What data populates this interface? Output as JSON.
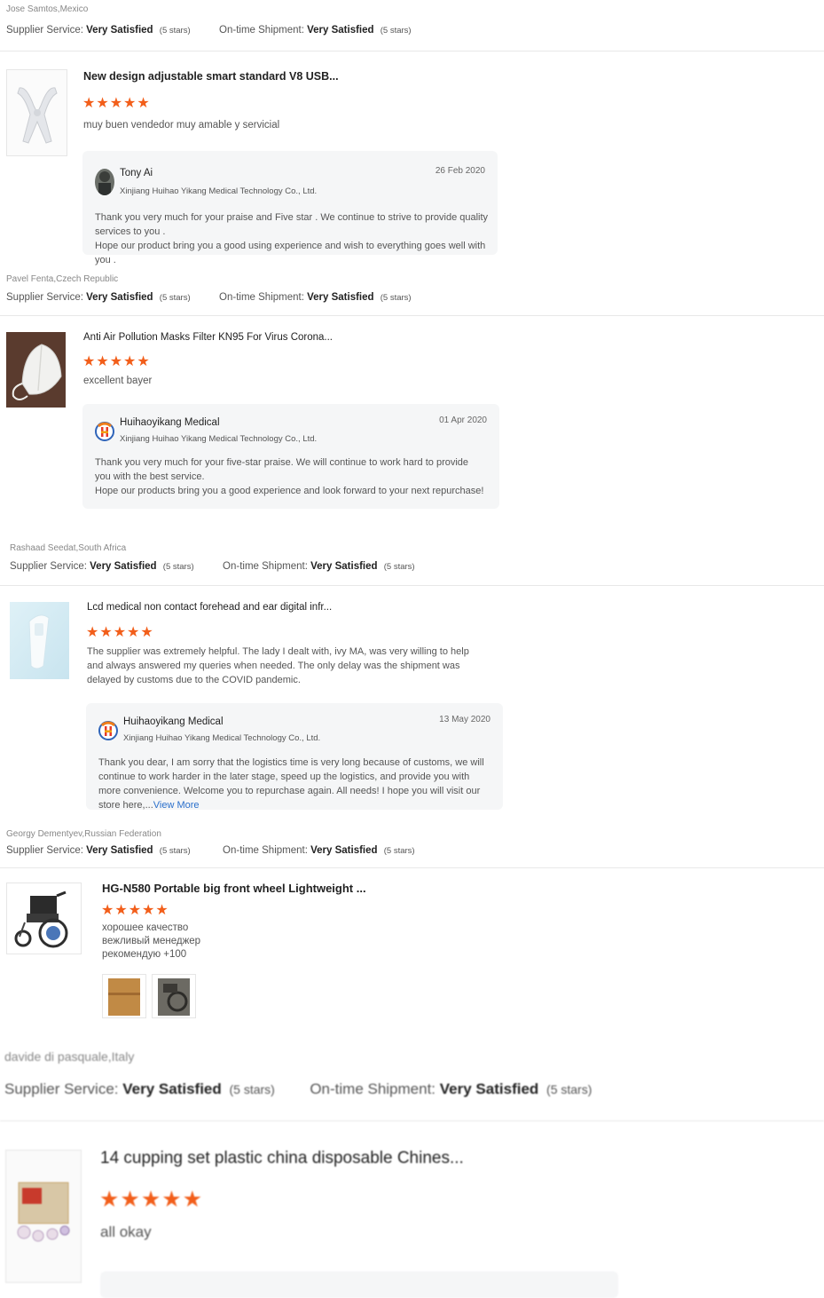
{
  "reviews": [
    {
      "reviewer": "Jose Samtos,Mexico",
      "supplier_label": "Supplier Service:",
      "supplier_value": "Very Satisfied",
      "supplier_stars": "(5 stars)",
      "shipment_label": "On-time Shipment:",
      "shipment_value": "Very Satisfied",
      "shipment_stars": "(5 stars)",
      "product_title": "New design adjustable smart standard V8 USB...",
      "stars": "★★★★★",
      "comment": "muy  buen vendedor muy amable y servicial",
      "reply": {
        "name": "Tony Ai",
        "company": "Xinjiang Huihao Yikang Medical Technology Co., Ltd.",
        "date": "26 Feb 2020",
        "text_line1": "Thank you very much for your praise and Five star . We continue to strive to provide quality services to you .",
        "text_line2": "Hope our product bring you a good using experience  and wish to everything goes well with you ."
      }
    },
    {
      "reviewer": "Pavel Fenta,Czech Republic",
      "supplier_label": "Supplier Service:",
      "supplier_value": "Very Satisfied",
      "supplier_stars": "(5 stars)",
      "shipment_label": "On-time Shipment:",
      "shipment_value": "Very Satisfied",
      "shipment_stars": "(5 stars)",
      "product_title": "Anti Air Pollution Masks Filter KN95 For Virus Corona...",
      "stars": "★★★★★",
      "comment": "excellent bayer",
      "reply": {
        "name": "Huihaoyikang Medical",
        "company": "Xinjiang Huihao Yikang Medical Technology Co., Ltd.",
        "date": "01 Apr 2020",
        "text_line1": "Thank you very much for your five-star praise. We will continue to work hard to provide you with the best service.",
        "text_line2": "Hope our products bring you a good experience and look forward to your next repurchase!"
      }
    },
    {
      "reviewer": "Rashaad Seedat,South Africa",
      "supplier_label": "Supplier Service:",
      "supplier_value": "Very Satisfied",
      "supplier_stars": "(5 stars)",
      "shipment_label": "On-time Shipment:",
      "shipment_value": "Very Satisfied",
      "shipment_stars": "(5 stars)",
      "product_title": "Lcd medical non contact forehead and ear digital infr...",
      "stars": "★★★★★",
      "comment": "The supplier was extremely helpful. The lady I dealt with, ivy MA, was very willing to help and always answered my queries when needed. The only delay was the shipment was delayed by customs due to the COVID pandemic.",
      "reply": {
        "name": "Huihaoyikang Medical",
        "company": "Xinjiang Huihao Yikang Medical Technology Co., Ltd.",
        "date": "13 May 2020",
        "text": "Thank you dear, I am sorry that the logistics time is very long because of customs, we will continue to work harder in the later stage, speed up the logistics, and provide you with more convenience. Welcome you to repurchase again. All needs! I hope you will visit our store here,...",
        "view_more": "View More"
      }
    },
    {
      "reviewer": "Georgy Dementyev,Russian Federation",
      "supplier_label": "Supplier Service:",
      "supplier_value": "Very Satisfied",
      "supplier_stars": "(5 stars)",
      "shipment_label": "On-time Shipment:",
      "shipment_value": "Very Satisfied",
      "shipment_stars": "(5 stars)",
      "product_title": "HG-N580 Portable big front wheel Lightweight ...",
      "stars": "★★★★★",
      "comment_lines": [
        "хорошее качество",
        "вежливый менеджер",
        "рекомендую +100"
      ]
    },
    {
      "reviewer": "davide di pasquale,Italy",
      "supplier_label": "Supplier Service:",
      "supplier_value": "Very Satisfied",
      "supplier_stars": "(5 stars)",
      "shipment_label": "On-time Shipment:",
      "shipment_value": "Very Satisfied",
      "shipment_stars": "(5 stars)",
      "product_title": "14 cupping set plastic china disposable Chines...",
      "stars": "★★★★★",
      "comment": "all okay"
    }
  ],
  "colors": {
    "star": "#f25e1a",
    "link": "#2a6fcb",
    "reply_bg": "#f5f6f7",
    "divider": "#e8e8e8"
  },
  "icons": [
    "posture-corrector-image",
    "kn95-mask-image",
    "thermometer-image",
    "wheelchair-image",
    "cupping-set-image",
    "avatar-photo",
    "huihao-logo-icon"
  ]
}
